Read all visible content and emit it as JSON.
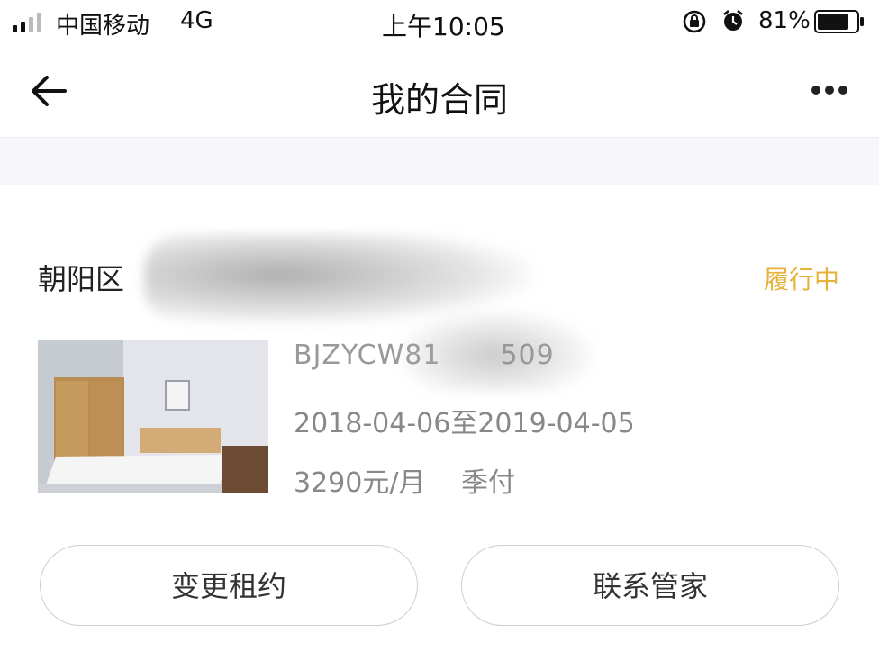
{
  "status_bar": {
    "carrier": "中国移动",
    "network": "4G",
    "time": "上午10:05",
    "battery": "81%",
    "battery_level": 0.81
  },
  "nav": {
    "title": "我的合同"
  },
  "contract": {
    "address": "朝阳区",
    "status": "履行中",
    "code": "BJZYCW81",
    "code_tail": "509",
    "dates": "2018-04-06至2019-04-05",
    "rent": "3290元/月",
    "pay_frequency": "季付",
    "status_color": "#e7b23a"
  },
  "actions": {
    "change_lease": "变更租约",
    "contact_manager": "联系管家"
  }
}
